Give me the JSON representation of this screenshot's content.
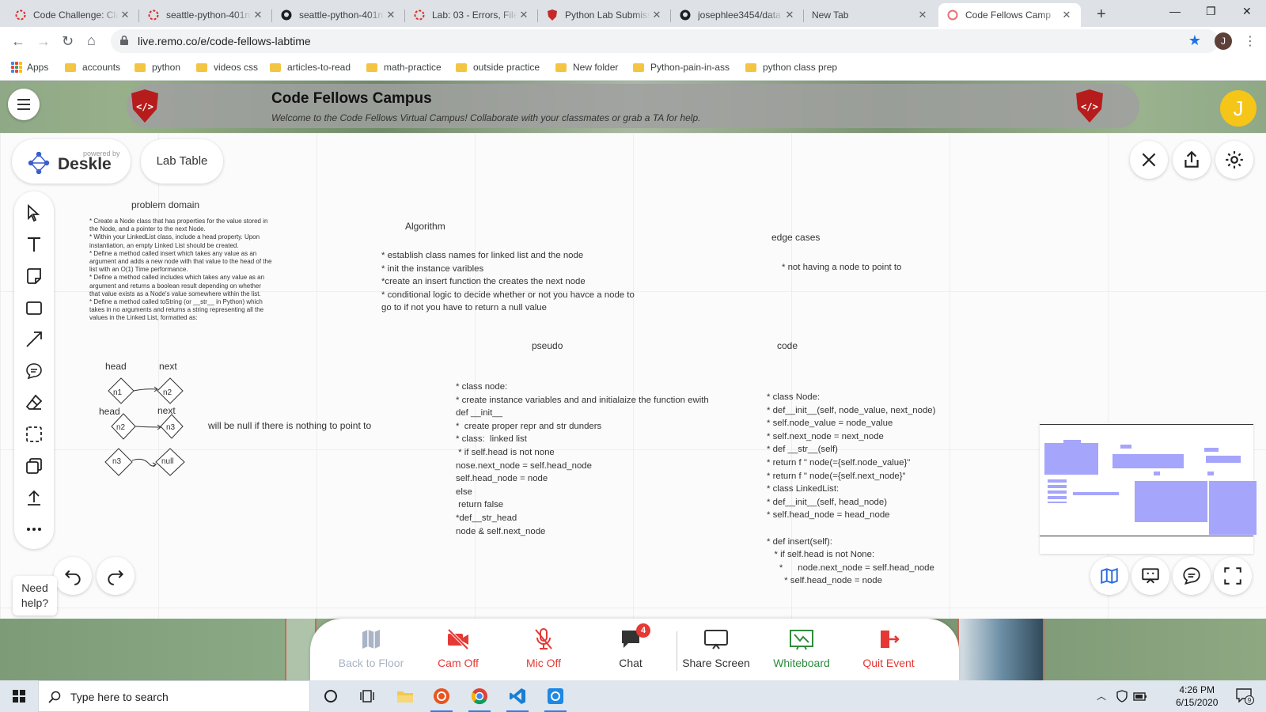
{
  "browser": {
    "tabs": [
      {
        "title": "Code Challenge: Cla",
        "icon": "spinner-icon"
      },
      {
        "title": "seattle-python-401n",
        "icon": "spinner-icon"
      },
      {
        "title": "seattle-python-401n",
        "icon": "github-icon"
      },
      {
        "title": "Lab: 03 - Errors, Files",
        "icon": "spinner-icon"
      },
      {
        "title": "Python Lab Submiss",
        "icon": "code-fellows-icon"
      },
      {
        "title": "josephlee3454/data",
        "icon": "github-icon"
      },
      {
        "title": "New Tab",
        "icon": ""
      },
      {
        "title": "Code Fellows Camp",
        "icon": "remo-icon",
        "active": true
      }
    ],
    "url": "live.remo.co/e/code-fellows-labtime",
    "profile_initial": "J",
    "bookmarks": [
      "Apps",
      "accounts",
      "python",
      "videos css",
      "articles-to-read",
      "math-practice",
      "outside practice",
      "New folder",
      "Python-pain-in-ass",
      "python class prep"
    ]
  },
  "header": {
    "title": "Code Fellows Campus",
    "subtitle": "Welcome to the Code Fellows Virtual Campus! Collaborate with your classmates or grab a TA for help.",
    "avatar_initial": "J"
  },
  "whiteboard": {
    "brand_powered": "powered by",
    "brand_name": "Deskle",
    "table_name": "Lab Table",
    "problem_domain": {
      "title": "problem domain",
      "text": "* Create a Node class that has properties for the value stored in\nthe Node, and a pointer to the next Node.\n* Within your LinkedList class, include a head property. Upon\ninstantiation, an empty Linked List should be created.\n* Define a method called insert which takes any value as an\nargument and adds a new node with that value to the head of the\nlist with an O(1) Time performance.\n* Define a method called includes which takes any value as an\nargument and returns a boolean result depending on whether\nthat value exists as a Node's value somewhere within the list.\n* Define a method called toString (or __str__ in Python) which\ntakes in no arguments and returns a string representing all the\nvalues in the Linked List, formatted as:"
    },
    "algorithm": {
      "title": "Algorithm",
      "text": "* establish class names for linked list and the node\n* init the instance varibles\n*create an insert function the creates the next node\n* conditional logic to decide whether or not you havce a node to\ngo to if not you have to return a null value"
    },
    "edge_cases": {
      "title": "edge cases",
      "text": "* not having a node to point to"
    },
    "diagram": {
      "head1": "head",
      "next1": "next",
      "head2": "head",
      "next2": "next",
      "nodes": [
        "n1",
        "n2",
        "n2",
        "n3",
        "n3",
        "null"
      ],
      "note": "will be null if there is nothing to point to"
    },
    "pseudo": {
      "title": "pseudo",
      "text": "* class node:\n* create instance variables and and initialaize the function ewith\ndef __init__\n*  create proper repr and str dunders\n* class:  linked list\n * if self.head is not none\nnose.next_node = self.head_node\nself.head_node = node\nelse\n return false\n*def__str_head\nnode & self.next_node"
    },
    "code": {
      "title": "code",
      "text": "* class Node:\n* def__init__(self, node_value, next_node)\n* self.node_value = node_value\n* self.next_node = next_node\n* def __str__(self)\n* return f \" node(={self.node_value}\"\n* return f \" node(={self.next_node}\"\n* class LinkedList:\n* def__init__(self, head_node)\n* self.head_node = head_node\n\n* def insert(self):\n   * if self.head is not None:\n     *      node.next_node = self.head_node\n       * self.head_node = node"
    },
    "need_help": "Need\nhelp?"
  },
  "callbar": {
    "buttons": [
      {
        "label": "Back to Floor",
        "icon": "map-icon",
        "color": "#aab4c6"
      },
      {
        "label": "Cam Off",
        "icon": "camera-off-icon",
        "color": "#e53935"
      },
      {
        "label": "Mic Off",
        "icon": "mic-off-icon",
        "color": "#e53935"
      },
      {
        "label": "Chat",
        "icon": "chat-icon",
        "color": "#333333",
        "badge": "4"
      },
      {
        "label": "Share Screen",
        "icon": "monitor-icon",
        "color": "#333333"
      },
      {
        "label": "Whiteboard",
        "icon": "whiteboard-icon",
        "color": "#2e8b3d"
      },
      {
        "label": "Quit Event",
        "icon": "exit-icon",
        "color": "#e53935"
      }
    ]
  },
  "taskbar": {
    "search_placeholder": "Type here to search",
    "time": "4:26 PM",
    "date": "6/15/2020",
    "notifications": "9"
  }
}
